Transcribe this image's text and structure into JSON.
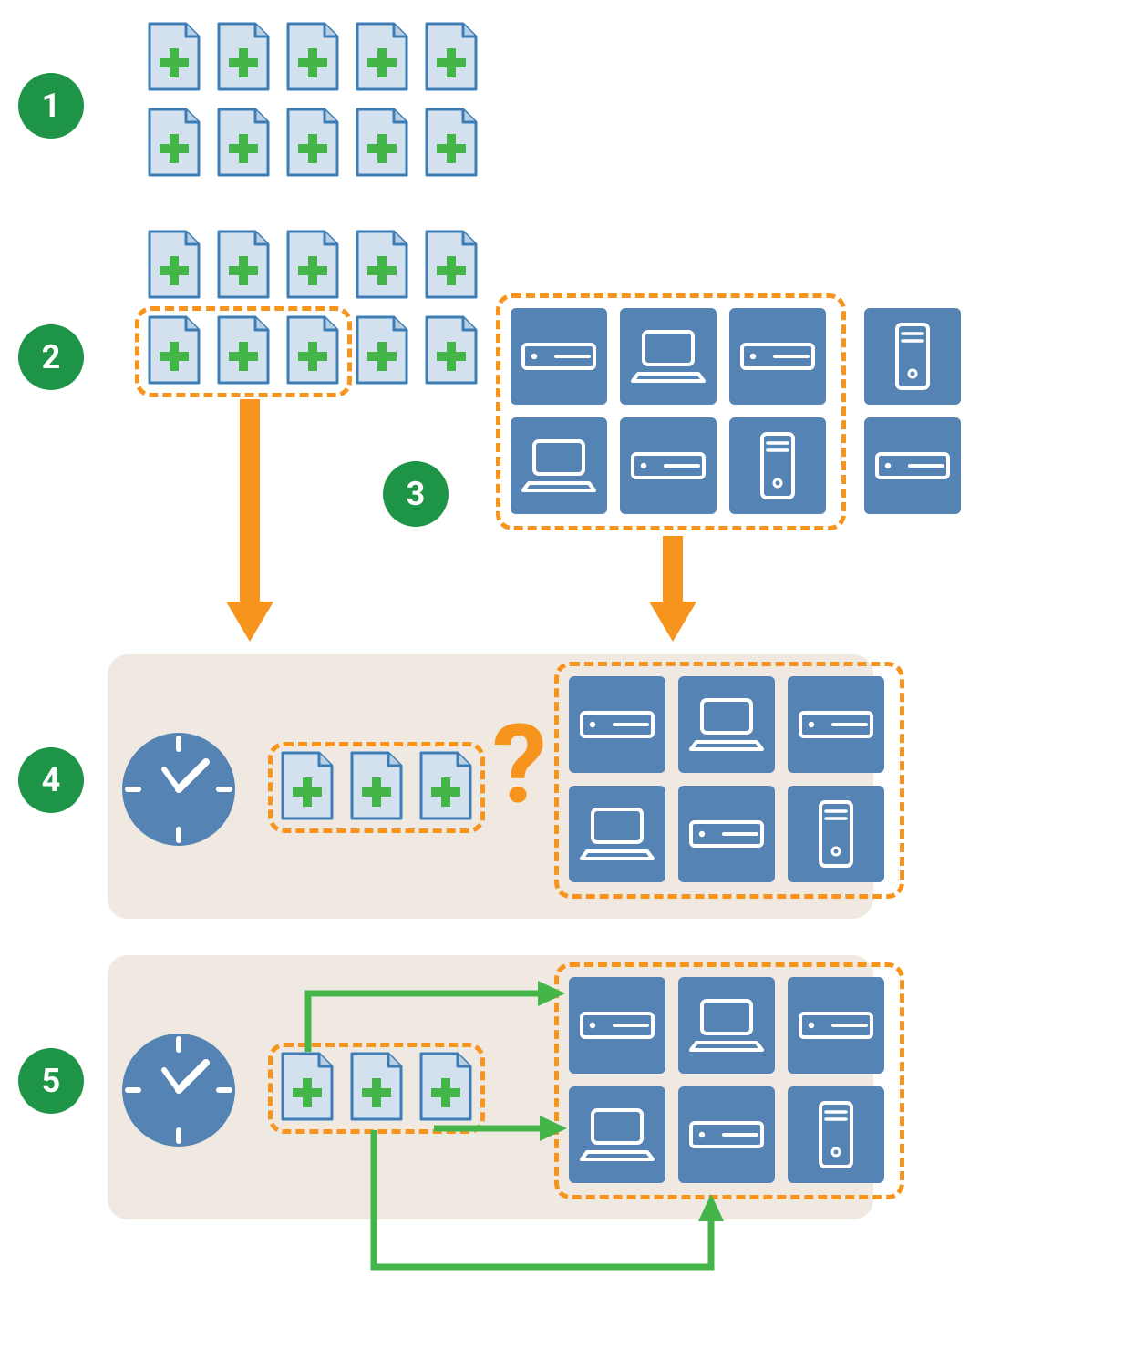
{
  "colors": {
    "green": "#1E9447",
    "brightGreen": "#44B649",
    "orange": "#F7941D",
    "blue": "#5583B3",
    "lightBlue": "#D3E0ED",
    "panel": "#EFE9E2",
    "white": "#FFFFFF",
    "docStroke": "#3D7DB6"
  },
  "steps": {
    "s1": "1",
    "s2": "2",
    "s3": "3",
    "s4": "4",
    "s5": "5"
  },
  "glyphs": {
    "question": "?"
  },
  "icons": {
    "patch": "plus-file-icon",
    "clock": "clock-icon",
    "rack": "rack-server-icon",
    "laptop": "laptop-icon",
    "tower": "tower-server-icon",
    "arrowDown": "arrow-down-icon",
    "arrowRight": "arrow-right-icon"
  },
  "layout": {
    "step1_patch_rows": [
      {
        "count": 5
      },
      {
        "count": 5
      }
    ],
    "step2_patch_rows": [
      {
        "count": 5
      },
      {
        "count": 5,
        "selected_count": 3
      }
    ],
    "step3_devices_main": [
      "rack",
      "laptop",
      "rack",
      "laptop",
      "rack",
      "tower"
    ],
    "step3_devices_extra": [
      "tower",
      "rack"
    ],
    "step4_patches": 3,
    "step4_devices": [
      "rack",
      "laptop",
      "rack",
      "laptop",
      "rack",
      "tower"
    ],
    "step5_patches": 3,
    "step5_devices": [
      "rack",
      "laptop",
      "rack",
      "laptop",
      "rack",
      "tower"
    ]
  }
}
